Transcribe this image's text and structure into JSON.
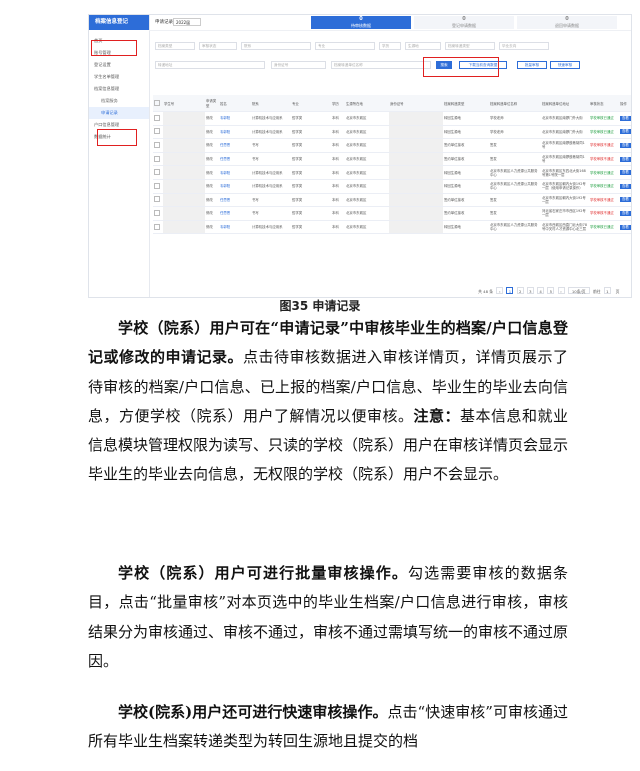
{
  "app": {
    "brand": "档案信息登记",
    "nav": [
      "首页",
      "账号管理",
      "登记设置",
      "学生名单管理",
      "档案信息管理",
      "档案服务",
      "申请记录",
      "户口信息管理",
      "数据统计"
    ]
  },
  "topbar": {
    "label": "申请记录",
    "year": "2022届",
    "tabs": [
      {
        "count": "0",
        "label": "待审核数据"
      },
      {
        "count": "0",
        "label": "登记申请数据"
      },
      {
        "count": "0",
        "label": "退回申请数据"
      }
    ]
  },
  "filters": {
    "row1": [
      "档案类型",
      "审核状态",
      "院系",
      "专业",
      "学历",
      "生源地",
      "档案转递类型",
      "毕业去向"
    ],
    "row2": [
      "转递地址",
      "身份证号",
      "档案转递单位名称"
    ],
    "search": "搜索",
    "download": "下载当前查询数据",
    "batch": "批量审核",
    "quick": "快速审核"
  },
  "table": {
    "headers": [
      "",
      "学生号",
      "申请类型",
      "姓名",
      "院系",
      "专业",
      "学历",
      "生源所在地",
      "身份证号",
      "档案转递类型",
      "档案转递单位名称",
      "档案转递单位地址",
      "审核状态",
      "操作"
    ],
    "rows": [
      [
        "修改",
        "韦郭阳",
        "计算机技术与应用系",
        "哲学类",
        "本科",
        "北京市东城区",
        "转回生源地",
        "学校老师",
        "北京市东城区南锣门外大街",
        "学校审核已通过"
      ],
      [
        "修改",
        "韦郭阳",
        "计算机技术与应用系",
        "哲学类",
        "本科",
        "北京市东城区",
        "转回生源地",
        "学校老师",
        "北京市东城区南锣门外大街",
        "学校审核已通过"
      ],
      [
        "修改",
        "任思恩",
        "书写",
        "哲学类",
        "本科",
        "北京市东城区",
        "签约单位接收",
        "签发",
        "北京市东城区南锣鼓巷胡同1号",
        "学校审核不通过"
      ],
      [
        "修改",
        "任思恩",
        "书写",
        "哲学类",
        "本科",
        "北京市东城区",
        "签约单位接收",
        "签发",
        "北京市东城区南锣鼓巷胡同1号",
        "学校审核不通过"
      ],
      [
        "修改",
        "韦郭阳",
        "计算机技术与应用系",
        "哲学类",
        "本科",
        "北京市东城区",
        "转回生源地",
        "北京市东城区人力资源公共服务中心",
        "北京市东城区东四北大街168号第1号院一层",
        "学校审核已通过"
      ],
      [
        "修改",
        "韦郭阳",
        "计算机技术与应用系",
        "哲学类",
        "本科",
        "北京市东城区",
        "转回生源地",
        "北京市东城区人力资源公共服务中心",
        "北京市东城区朝内大街192号一层（使用申请记录操作）",
        "学校审核已通过"
      ],
      [
        "修改",
        "任思恩",
        "书写",
        "哲学类",
        "本科",
        "北京市东城区",
        "签约单位接收",
        "签发",
        "北京市东城区朝内大街192号一层",
        "学校审核不通过"
      ],
      [
        "修改",
        "任思恩",
        "书写",
        "哲学类",
        "本科",
        "北京市东城区",
        "签约单位接收",
        "签发",
        "河北省石家庄市市西区192号一层",
        "学校审核不通过"
      ],
      [
        "修改",
        "韦郭阳",
        "计算机技术与应用系",
        "哲学类",
        "本科",
        "北京市东城区",
        "转回生源地",
        "北京市东城区人力资源公共服务中心",
        "北京市西城区西直门北大街78号中关村人才资源中心北三层",
        "学校审核已通过"
      ]
    ],
    "op": "查看"
  },
  "pager": {
    "total": "共 48 条",
    "pages": [
      "1",
      "2",
      "3",
      "4",
      "5"
    ],
    "size": "10条/页",
    "goto": "前往",
    "page": "1",
    "unit": "页"
  },
  "caption": "图35 申请记录",
  "paragraphs": [
    {
      "bold": "学校（院系）用户可在“申请记录”中审核毕业生的档案/户口信息登记或修改的申请记录。",
      "normal": "点击待审核数据进入审核详情页，详情页展示了待审核的档案/户口信息、已上报的档案/户口信息、毕业生的毕业去向信息，方便学校（院系）用户了解情况以便审核。",
      "bold2": "注意：",
      "normal2": "基本信息和就业信息模块管理权限为读写、只读的学校（院系）用户在审核详情页会显示毕业生的毕业去向信息，无权限的学校（院系）用户不会显示。"
    },
    {
      "bold": "学校（院系）用户可进行批量审核操作。",
      "normal": "勾选需要审核的数据条目，点击“批量审核”对本页选中的毕业生档案/户口信息进行审核，审核结果分为审核通过、审核不通过，审核不通过需填写统一的审核不通过原因。"
    },
    {
      "bold": "学校(院系)用户还可进行快速审核操作。",
      "normal": "点击“快速审核”可审核通过所有毕业生档案转递类型为转回生源地且提交的档"
    }
  ]
}
